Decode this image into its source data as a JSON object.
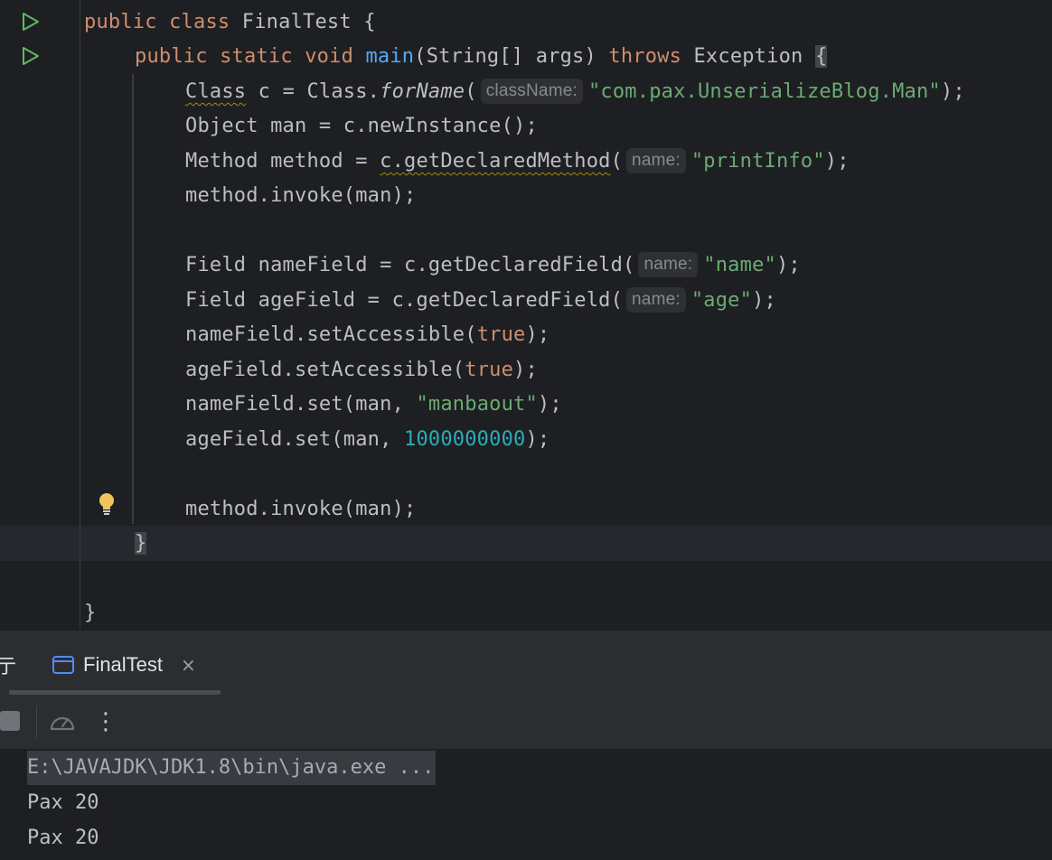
{
  "editor": {
    "lines": [
      {
        "kw1": "public class ",
        "name": "FinalTest",
        "rest": " {"
      },
      {
        "kw1": "public static void ",
        "method": "main",
        "params": "(String[] args) ",
        "kw2": "throws",
        "exc": " Exception ",
        "brace": "{"
      },
      {
        "type": "Class",
        "mid": " c = Class.",
        "call": "forName",
        "open": "(",
        "hint": "className:",
        "arg": "\"com.pax.UnserializeBlog.Man\"",
        "close": ");"
      },
      {
        "text": "Object man = c.newInstance();"
      },
      {
        "pre": "Method method = ",
        "warn": "c.getDeclaredMethod",
        "open": "(",
        "hint": "name:",
        "arg": "\"printInfo\"",
        "close": ");"
      },
      {
        "text": "method.invoke(man);"
      },
      {
        "pre": "Field nameField = c.getDeclaredField(",
        "hint": "name:",
        "arg": "\"name\"",
        "close": ");"
      },
      {
        "pre": "Field ageField = c.getDeclaredField(",
        "hint": "name:",
        "arg": "\"age\"",
        "close": ");"
      },
      {
        "pre": "nameField.setAccessible(",
        "kw": "true",
        "close": ");"
      },
      {
        "pre": "ageField.setAccessible(",
        "kw": "true",
        "close": ");"
      },
      {
        "pre": "nameField.set(man, ",
        "arg": "\"manbaout\"",
        "close": ");"
      },
      {
        "pre": "ageField.set(man, ",
        "num": "1000000000",
        "close": ");"
      },
      {
        "text": "method.invoke(man);"
      },
      {
        "text": "}"
      },
      {
        "text": "}"
      }
    ]
  },
  "run_panel": {
    "partial_tab_label": "亍",
    "tab_label": "FinalTest",
    "close_glyph": "×",
    "more_glyph": "⋮"
  },
  "console": {
    "command": "E:\\JAVAJDK\\JDK1.8\\bin\\java.exe ...",
    "output": [
      "Pax 20",
      "Pax 20"
    ]
  },
  "colors": {
    "background": "#1e1f22",
    "keyword": "#cf8e6d",
    "string": "#6aab73",
    "number": "#2aacb8",
    "function": "#56a8f5",
    "run_icon": "#5fb865",
    "bulb": "#f2c55c"
  },
  "icons": [
    "run-gutter-icon",
    "run-gutter-icon",
    "intention-bulb-icon",
    "run-config-icon",
    "close-icon",
    "stop-icon",
    "profiler-gauge-icon",
    "more-options-icon"
  ]
}
